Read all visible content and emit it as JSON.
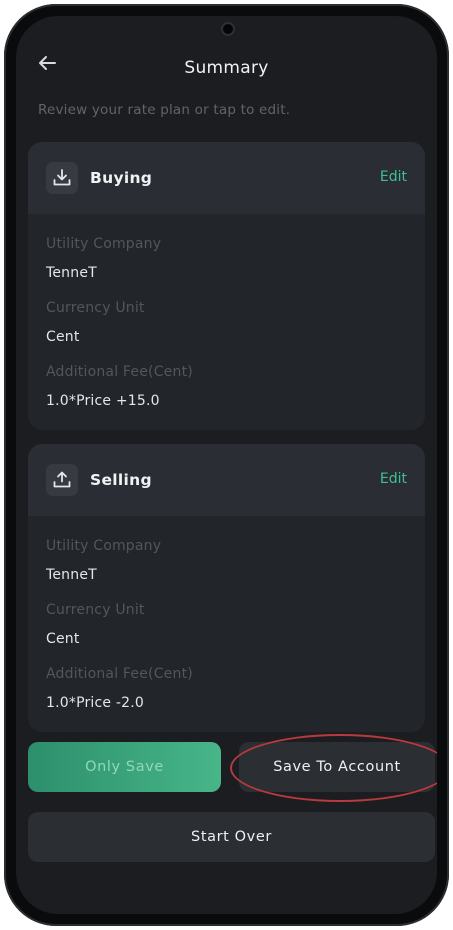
{
  "header": {
    "title": "Summary",
    "subtitle": "Review your rate plan or tap to edit."
  },
  "buying": {
    "title": "Buying",
    "edit_label": "Edit",
    "fields": [
      {
        "label": "Utility Company",
        "value": "TenneT"
      },
      {
        "label": "Currency Unit",
        "value": "Cent"
      },
      {
        "label": "Additional Fee(Cent)",
        "value": "1.0*Price +15.0"
      }
    ]
  },
  "selling": {
    "title": "Selling",
    "edit_label": "Edit",
    "fields": [
      {
        "label": "Utility Company",
        "value": "TenneT"
      },
      {
        "label": "Currency Unit",
        "value": "Cent"
      },
      {
        "label": "Additional Fee(Cent)",
        "value": "1.0*Price -2.0"
      }
    ]
  },
  "actions": {
    "only_save": "Only Save",
    "save_to_account": "Save To Account",
    "start_over": "Start Over"
  },
  "colors": {
    "accent": "#3fbf93",
    "background": "#1b1d21",
    "highlight_circle": "#b63a3e"
  }
}
